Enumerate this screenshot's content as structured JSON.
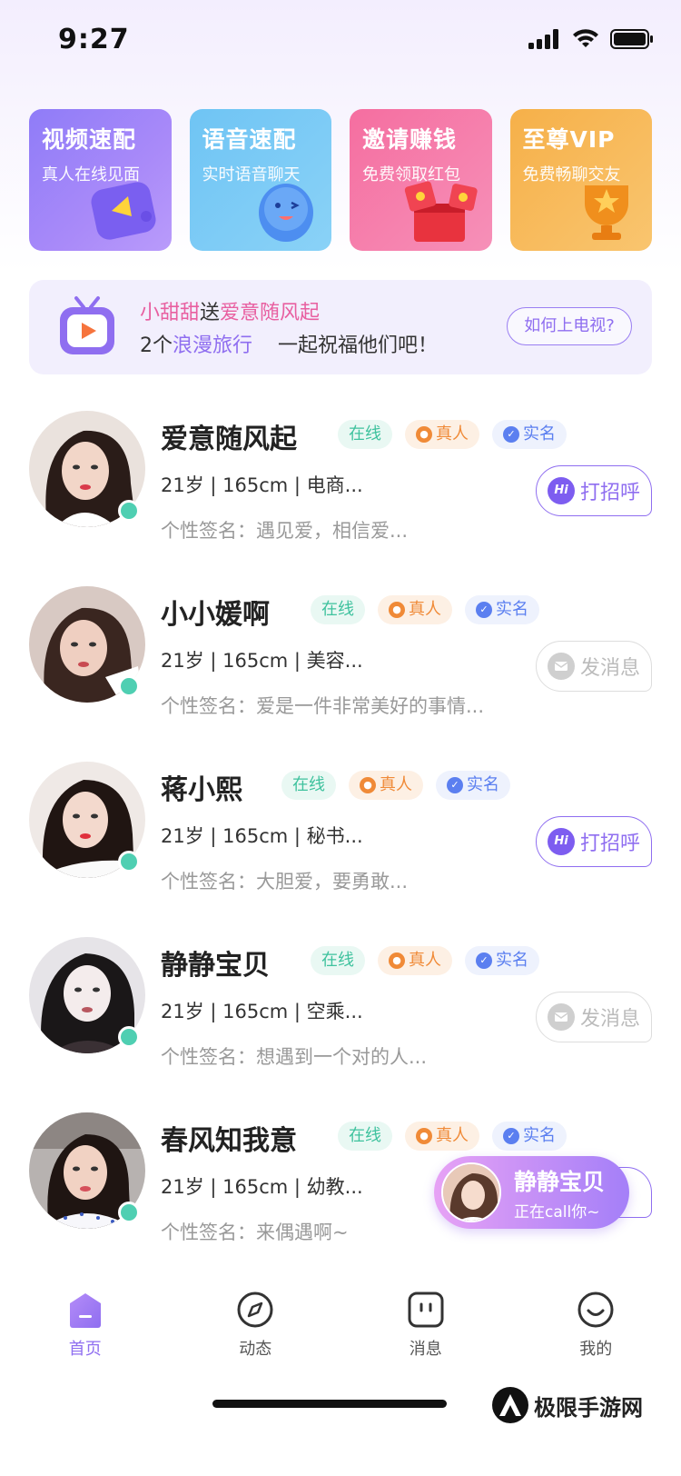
{
  "status_bar": {
    "time": "9:27"
  },
  "features": [
    {
      "title": "视频速配",
      "subtitle": "真人在线见面",
      "icon": "video-chat-icon"
    },
    {
      "title": "语音速配",
      "subtitle": "实时语音聊天",
      "icon": "voice-mascot-icon"
    },
    {
      "title": "邀请赚钱",
      "subtitle": "免费领取红包",
      "icon": "red-packet-icon"
    },
    {
      "title": "至尊VIP",
      "subtitle": "免费畅聊交友",
      "icon": "trophy-icon"
    }
  ],
  "banner": {
    "sender": "小甜甜",
    "verb": "送",
    "receiver": "爱意随风起",
    "count": "2个",
    "gift": "浪漫旅行",
    "wish": "一起祝福他们吧！",
    "button": "如何上电视?"
  },
  "users": [
    {
      "name": "爱意随风起",
      "tags": [
        "在线",
        "真人",
        "实名"
      ],
      "info": "21岁 | 165cm | 电商...",
      "signature": "个性签名：遇见爱，相信爱...",
      "action": "打招呼",
      "action_type": "greet"
    },
    {
      "name": "小小媛啊",
      "tags": [
        "在线",
        "真人",
        "实名"
      ],
      "info": "21岁 | 165cm | 美容...",
      "signature": "个性签名：爱是一件非常美好的事情...",
      "action": "发消息",
      "action_type": "message"
    },
    {
      "name": "蒋小熙",
      "tags": [
        "在线",
        "真人",
        "实名"
      ],
      "info": "21岁 | 165cm | 秘书...",
      "signature": "个性签名：大胆爱，要勇敢...",
      "action": "打招呼",
      "action_type": "greet"
    },
    {
      "name": "静静宝贝",
      "tags": [
        "在线",
        "真人",
        "实名"
      ],
      "info": "21岁 | 165cm | 空乘...",
      "signature": "个性签名：想遇到一个对的人...",
      "action": "发消息",
      "action_type": "message"
    },
    {
      "name": "春风知我意",
      "tags": [
        "在线",
        "真人",
        "实名"
      ],
      "info": "21岁 | 165cm | 幼教...",
      "signature": "个性签名：来偶遇啊~",
      "action": "",
      "action_type": "greet"
    }
  ],
  "call_float": {
    "name": "静静宝贝",
    "status": "正在call你~"
  },
  "tabs": [
    {
      "label": "首页",
      "icon": "home-icon",
      "active": true
    },
    {
      "label": "动态",
      "icon": "compass-icon",
      "active": false
    },
    {
      "label": "消息",
      "icon": "message-icon",
      "active": false
    },
    {
      "label": "我的",
      "icon": "smile-icon",
      "active": false
    }
  ],
  "watermark": "极限手游网",
  "colors": {
    "accent": "#8f6ef0",
    "online": "#4fcfb2",
    "pink": "#e85fa0"
  }
}
